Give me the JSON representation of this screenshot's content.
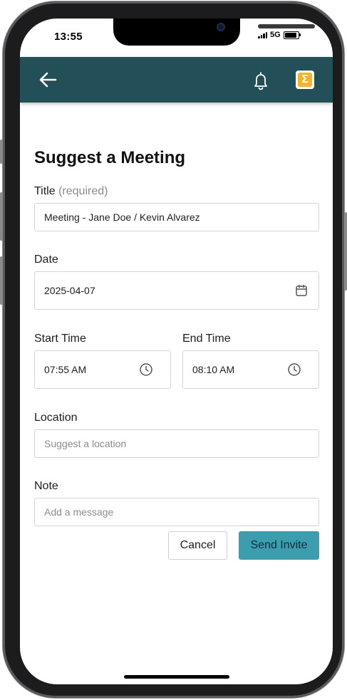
{
  "status_bar": {
    "time": "13:55",
    "network": "5G",
    "battery_level": 0.9
  },
  "app_bar": {
    "color": "#234f58",
    "logo_letter": "Σ",
    "logo_color": "#f3b32a"
  },
  "form": {
    "heading": "Suggest a Meeting",
    "title": {
      "label": "Title",
      "hint": "(required)",
      "value": "Meeting - Jane Doe / Kevin Alvarez"
    },
    "date": {
      "label": "Date",
      "value": "2025-04-07"
    },
    "start_time": {
      "label": "Start Time",
      "value": "07:55 AM"
    },
    "end_time": {
      "label": "End Time",
      "value": "08:10 AM"
    },
    "location": {
      "label": "Location",
      "placeholder": "Suggest a location"
    },
    "note": {
      "label": "Note",
      "placeholder": "Add a message"
    }
  },
  "actions": {
    "cancel_label": "Cancel",
    "send_label": "Send Invite",
    "send_color": "#3c9daf"
  }
}
